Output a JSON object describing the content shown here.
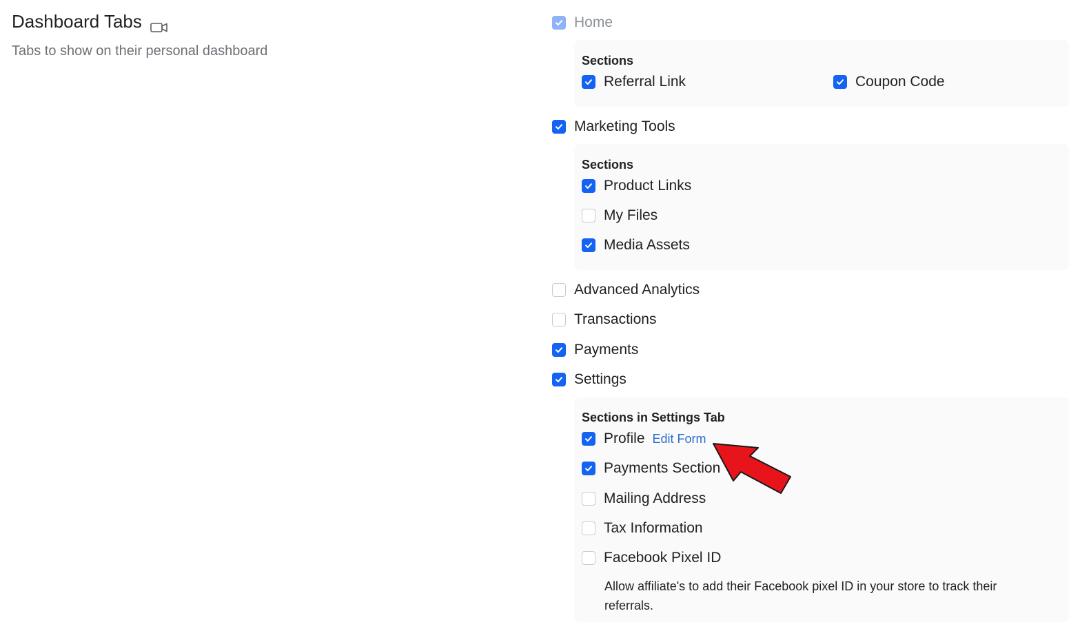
{
  "header": {
    "title": "Dashboard Tabs",
    "title_icon": "video-camera-icon",
    "subtitle": "Tabs to show on their personal dashboard"
  },
  "tabs": {
    "home": {
      "label": "Home",
      "checked": true,
      "disabled": true,
      "sections_heading": "Sections",
      "sections": [
        {
          "label": "Referral Link",
          "checked": true
        },
        {
          "label": "Coupon Code",
          "checked": true
        }
      ]
    },
    "marketing_tools": {
      "label": "Marketing Tools",
      "checked": true,
      "sections_heading": "Sections",
      "sections": [
        {
          "label": "Product Links",
          "checked": true
        },
        {
          "label": "My Files",
          "checked": false
        },
        {
          "label": "Media Assets",
          "checked": true
        }
      ]
    },
    "advanced_analytics": {
      "label": "Advanced Analytics",
      "checked": false
    },
    "transactions": {
      "label": "Transactions",
      "checked": false
    },
    "payments": {
      "label": "Payments",
      "checked": true
    },
    "settings": {
      "label": "Settings",
      "checked": true,
      "sections_heading": "Sections in Settings Tab",
      "sections": [
        {
          "label": "Profile",
          "checked": true,
          "link": "Edit Form"
        },
        {
          "label": "Payments Section",
          "checked": true
        },
        {
          "label": "Mailing Address",
          "checked": false
        },
        {
          "label": "Tax Information",
          "checked": false
        },
        {
          "label": "Facebook Pixel ID",
          "checked": false
        }
      ],
      "facebook_help": "Allow affiliate's to add their Facebook pixel ID in your store to track their referrals."
    }
  },
  "annotation": {
    "arrow_color": "#e8141c"
  },
  "colors": {
    "accent": "#1463f3",
    "link": "#2c6ecb"
  }
}
